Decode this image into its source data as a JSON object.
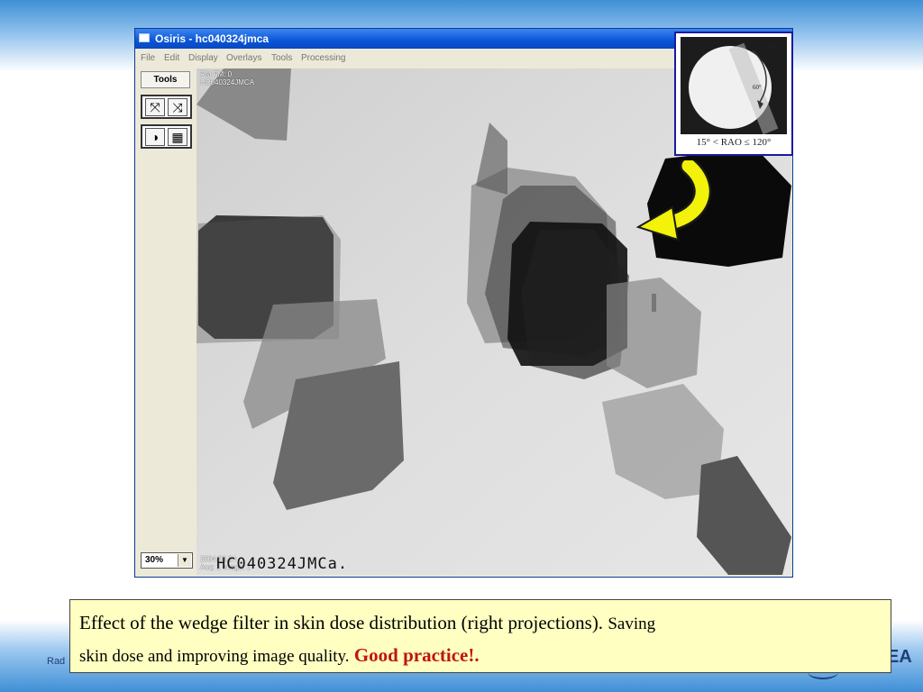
{
  "window": {
    "title": "Osiris - hc040324jmca",
    "menu": [
      "File",
      "Edit",
      "Display",
      "Overlays",
      "Tools",
      "Processing"
    ]
  },
  "left_panel": {
    "tools_label": "Tools",
    "zoom_value": "30%"
  },
  "viewport": {
    "overlay_top": [
      "RM FM: 0",
      "HC040324JMCA"
    ],
    "overlay_bottom": [
      "2004.03.24",
      "Acq: 1 Image: 1"
    ],
    "handwritten_label": "HC040324JMCa."
  },
  "inset": {
    "marker_top": "105°",
    "marker_mid": "60°",
    "caption": "15° < RAO ≤ 120°"
  },
  "caption": {
    "main": "Effect of the wedge filter in skin dose distribution (right projections).",
    "sub_a": "Saving",
    "sub_b": "skin dose and improving image quality.",
    "highlight": "Good practice!."
  },
  "footer": {
    "left": "Rad",
    "right": "EA"
  },
  "colors": {
    "highlight": "#c0140e",
    "caption_bg": "#ffffc2",
    "arrow": "#f2f20a"
  }
}
